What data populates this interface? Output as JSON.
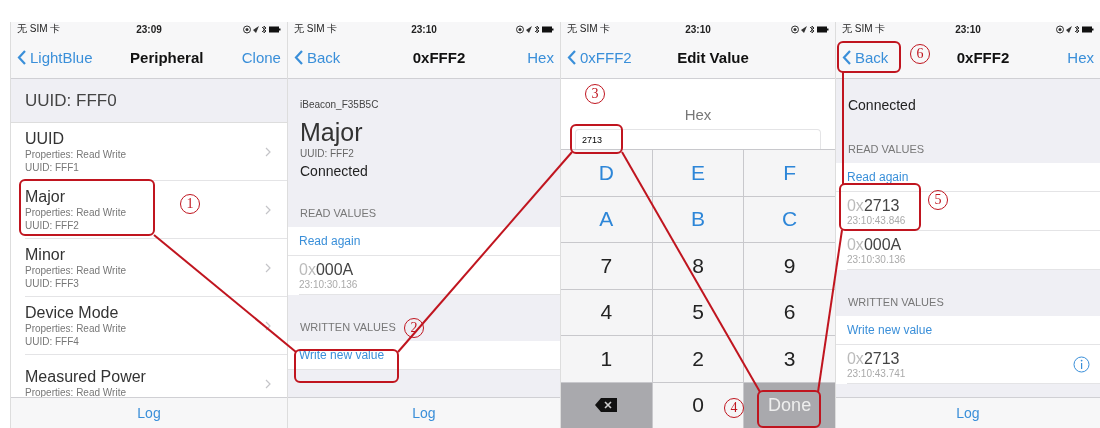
{
  "screens": [
    {
      "kind": "list",
      "status": {
        "carrier": "无 SIM 卡",
        "time": "23:09"
      },
      "nav": {
        "back": "LightBlue",
        "title": "Peripheral",
        "action": "Clone"
      },
      "section": "UUID: FFF0",
      "items": [
        {
          "title": "UUID",
          "properties": "Properties: Read Write",
          "uuid": "UUID: FFF1"
        },
        {
          "title": "Major",
          "properties": "Properties: Read Write",
          "uuid": "UUID: FFF2"
        },
        {
          "title": "Minor",
          "properties": "Properties: Read Write",
          "uuid": "UUID: FFF3"
        },
        {
          "title": "Device Mode",
          "properties": "Properties: Read Write",
          "uuid": "UUID: FFF4"
        },
        {
          "title": "Measured Power",
          "properties": "Properties: Read Write"
        }
      ],
      "tab": "Log"
    },
    {
      "kind": "detail",
      "status": {
        "carrier": "无 SIM 卡",
        "time": "23:10"
      },
      "nav": {
        "back": "Back",
        "title": "0xFFF2",
        "action": "Hex"
      },
      "device": "iBeacon_F35B5C",
      "name": "Major",
      "uuid": "UUID: FFF2",
      "connection": "Connected",
      "read_header": "READ VALUES",
      "read_action": "Read again",
      "read_values": [
        {
          "prefix": "0x",
          "value": "000A",
          "time": "23:10:30.136"
        }
      ],
      "written_header": "WRITTEN VALUES",
      "write_action": "Write new value",
      "tab": "Log"
    },
    {
      "kind": "keypad",
      "status": {
        "carrier": "无 SIM 卡",
        "time": "23:10"
      },
      "nav": {
        "back": "0xFFF2",
        "title": "Edit Value"
      },
      "format": "Hex",
      "input": "2713",
      "keys": [
        {
          "kind": "hex",
          "label": "D"
        },
        {
          "kind": "hex",
          "label": "E"
        },
        {
          "kind": "hex",
          "label": "F"
        },
        {
          "kind": "hex",
          "label": "A"
        },
        {
          "kind": "hex",
          "label": "B"
        },
        {
          "kind": "hex",
          "label": "C"
        },
        {
          "kind": "digit",
          "label": "7"
        },
        {
          "kind": "digit",
          "label": "8"
        },
        {
          "kind": "digit",
          "label": "9"
        },
        {
          "kind": "digit",
          "label": "4"
        },
        {
          "kind": "digit",
          "label": "5"
        },
        {
          "kind": "digit",
          "label": "6"
        },
        {
          "kind": "digit",
          "label": "1"
        },
        {
          "kind": "digit",
          "label": "2"
        },
        {
          "kind": "digit",
          "label": "3"
        },
        {
          "kind": "delete"
        },
        {
          "kind": "digit",
          "label": "0"
        },
        {
          "kind": "done",
          "label": "Done"
        }
      ]
    },
    {
      "kind": "detail",
      "status": {
        "carrier": "无 SIM 卡",
        "time": "23:10"
      },
      "nav": {
        "back": "Back",
        "title": "0xFFF2",
        "action": "Hex"
      },
      "connection": "Connected",
      "read_header": "READ VALUES",
      "read_action": "Read again",
      "read_values": [
        {
          "prefix": "0x",
          "value": "2713",
          "time": "23:10:43.846"
        },
        {
          "prefix": "0x",
          "value": "000A",
          "time": "23:10:30.136"
        }
      ],
      "written_header": "WRITTEN VALUES",
      "write_action": "Write new value",
      "written_values": [
        {
          "prefix": "0x",
          "value": "2713",
          "time": "23:10:43.741"
        }
      ],
      "tab": "Log"
    }
  ],
  "annotations": [
    {
      "label": "1"
    },
    {
      "label": "2"
    },
    {
      "label": "3"
    },
    {
      "label": "4"
    },
    {
      "label": "5"
    },
    {
      "label": "6"
    }
  ]
}
